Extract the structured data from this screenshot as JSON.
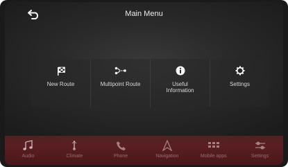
{
  "header": {
    "title": "Main Menu",
    "back_icon": "back-arrow-icon"
  },
  "menu": [
    {
      "label": "New Route",
      "icon": "checkered-flag-icon"
    },
    {
      "label": "Multipoint Route",
      "icon": "multipoint-route-icon"
    },
    {
      "label": "Useful\nInformation",
      "icon": "info-icon"
    },
    {
      "label": "Settings",
      "icon": "gear-icon"
    }
  ],
  "bottom_nav": [
    {
      "label": "Audio",
      "icon": "music-note-icon"
    },
    {
      "label": "Climate",
      "icon": "climate-icon"
    },
    {
      "label": "Phone",
      "icon": "phone-icon"
    },
    {
      "label": "Navigation",
      "icon": "navigation-icon"
    },
    {
      "label": "Mobile apps",
      "icon": "apps-grid-icon"
    },
    {
      "label": "Settings",
      "icon": "settings-sliders-icon"
    }
  ],
  "colors": {
    "screen_bg": "#2a2a2a",
    "bottom_bar": "#5a1f22",
    "text": "#ececec"
  }
}
